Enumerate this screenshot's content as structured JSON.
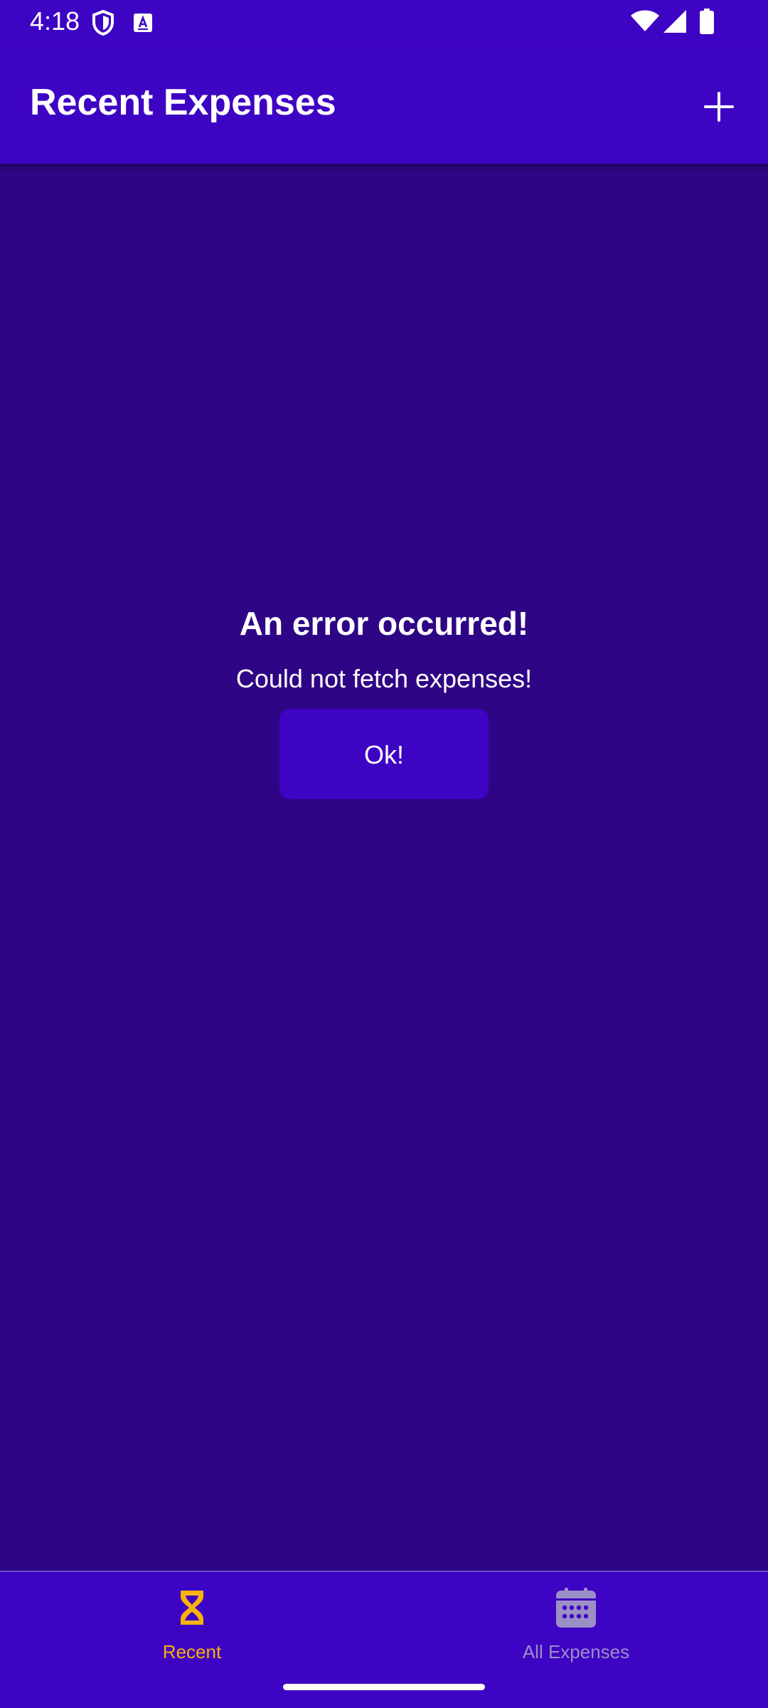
{
  "status_bar": {
    "time": "4:18"
  },
  "app_bar": {
    "title": "Recent Expenses",
    "add_icon": "plus-icon"
  },
  "error": {
    "title": "An error occurred!",
    "message": "Could not fetch expenses!",
    "button_label": "Ok!"
  },
  "bottom_nav": {
    "items": [
      {
        "label": "Recent",
        "icon": "hourglass-icon",
        "active": true
      },
      {
        "label": "All Expenses",
        "icon": "calendar-icon",
        "active": false
      }
    ]
  },
  "colors": {
    "header": "#3e04c3",
    "background": "#2e0584",
    "button": "#3e04c3",
    "active_nav": "#f9b10b",
    "inactive_nav": "#9b8fc7",
    "text": "#ffffff"
  }
}
